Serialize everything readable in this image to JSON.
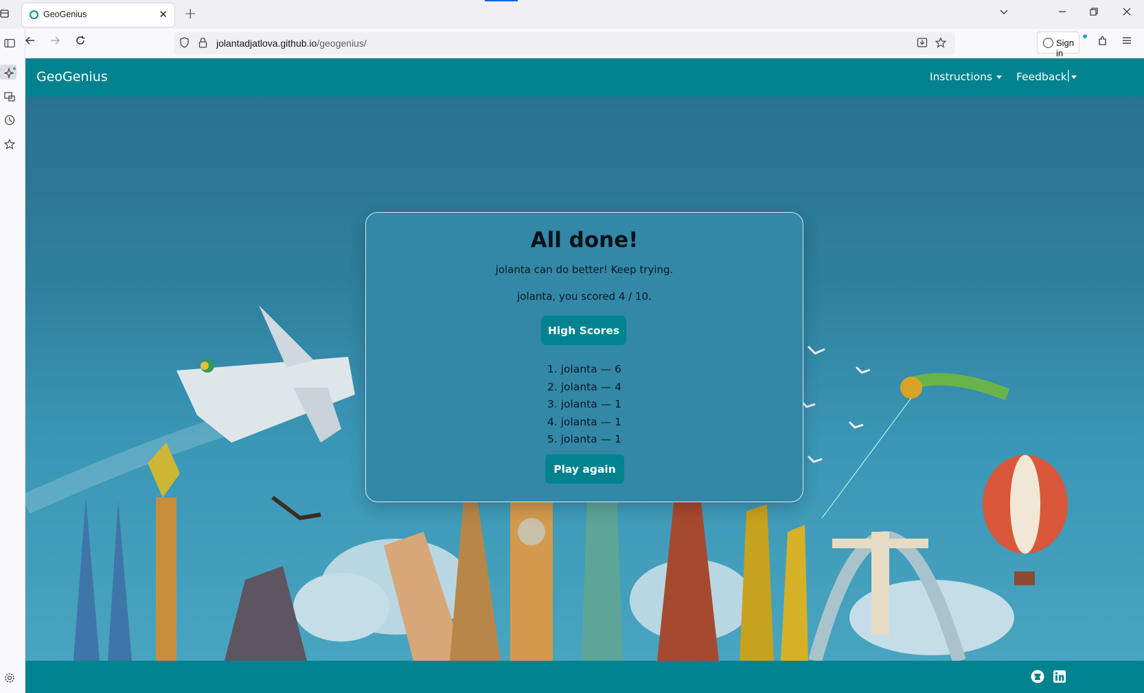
{
  "browser": {
    "tab_title": "GeoGenius",
    "url_domain": "jolantadjatlova.github.io",
    "url_path": "/geogenius/",
    "sign_in_label": "Sign in",
    "window_controls": [
      "minimize-icon",
      "restore-icon",
      "close-icon"
    ]
  },
  "site": {
    "brand": "GeoGenius",
    "menu": {
      "instructions": "Instructions",
      "feedback": "Feedback",
      "separator": "|"
    },
    "footer_icons": [
      "github-icon",
      "linkedin-icon"
    ]
  },
  "result": {
    "title": "All done!",
    "message": "jolanta can do better! Keep trying.",
    "score_text": "jolanta, you scored 4 / 10.",
    "high_scores_button": "High Scores",
    "high_scores": [
      "1. jolanta — 6",
      "2. jolanta — 4",
      "3. jolanta — 1",
      "4. jolanta — 1",
      "5. jolanta — 1"
    ],
    "play_again_button": "Play again"
  },
  "colors": {
    "header": "#00838f",
    "modal": "#3388a8",
    "button": "#00838f"
  }
}
